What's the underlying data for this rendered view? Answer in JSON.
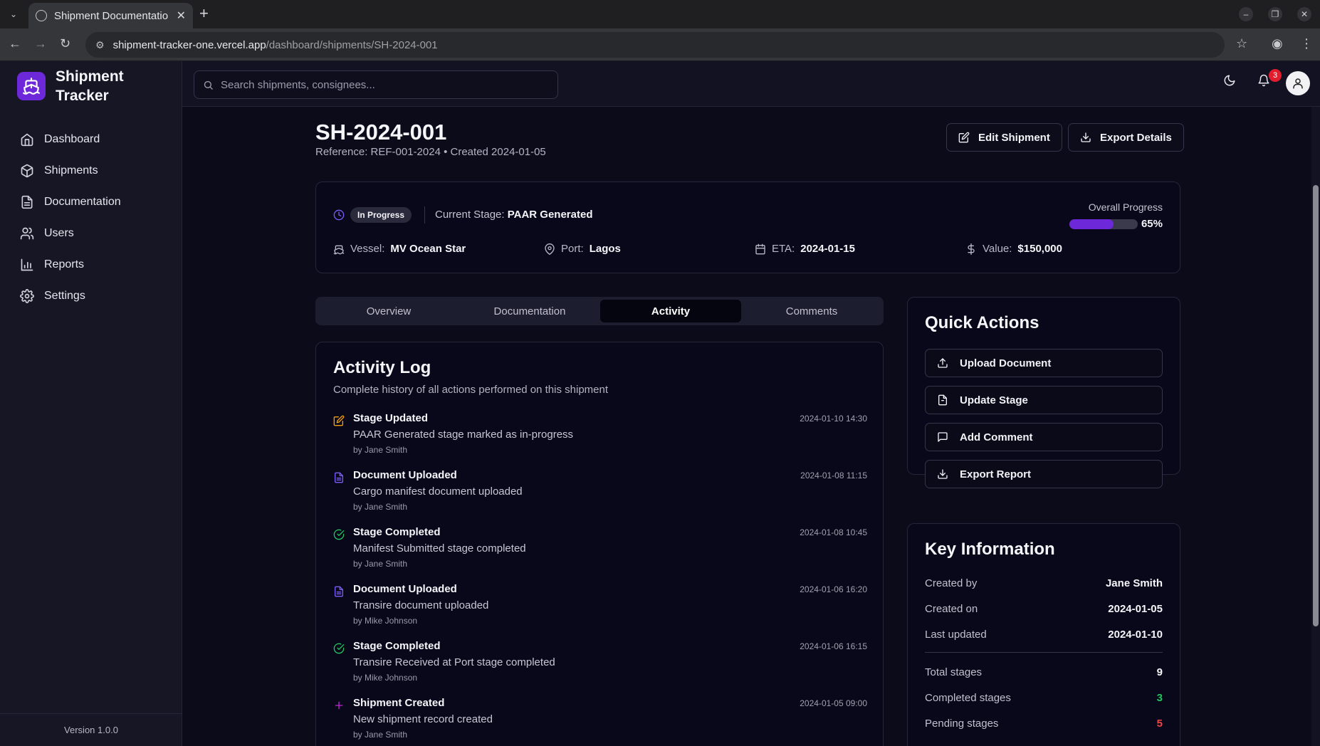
{
  "browser": {
    "tab_title": "Shipment Documentatio",
    "url_host": "shipment-tracker-one.vercel.app",
    "url_path": "/dashboard/shipments/SH-2024-001"
  },
  "brand": {
    "name": "Shipment Tracker",
    "accent": "#6d28d9"
  },
  "sidebar": {
    "items": [
      {
        "label": "Dashboard",
        "icon": "home-icon"
      },
      {
        "label": "Shipments",
        "icon": "package-icon"
      },
      {
        "label": "Documentation",
        "icon": "file-text-icon"
      },
      {
        "label": "Users",
        "icon": "users-icon"
      },
      {
        "label": "Reports",
        "icon": "bar-chart-icon"
      },
      {
        "label": "Settings",
        "icon": "gear-icon"
      }
    ],
    "version": "Version 1.0.0"
  },
  "topbar": {
    "search_placeholder": "Search shipments, consignees...",
    "notification_count": "3"
  },
  "shipment": {
    "id": "SH-2024-001",
    "subtitle": "Reference: REF-001-2024 • Created 2024-01-05",
    "edit_label": "Edit Shipment",
    "export_label": "Export Details",
    "status": "In Progress",
    "stage_label": "Current Stage:",
    "stage_value": "PAAR Generated",
    "progress_label": "Overall Progress",
    "progress_value": 65,
    "progress_text": "65%",
    "vessel_label": "Vessel:",
    "vessel_value": "MV Ocean Star",
    "port_label": "Port:",
    "port_value": "Lagos",
    "eta_label": "ETA:",
    "eta_value": "2024-01-15",
    "value_label": "Value:",
    "value_value": "$150,000"
  },
  "tabs": [
    "Overview",
    "Documentation",
    "Activity",
    "Comments"
  ],
  "activity": {
    "title": "Activity Log",
    "subtitle": "Complete history of all actions performed on this shipment",
    "items": [
      {
        "title": "Stage Updated",
        "desc": "PAAR Generated stage marked as in-progress",
        "by": "by Jane Smith",
        "ts": "2024-01-10 14:30",
        "icon": "edit-icon",
        "color": "#f59e0b"
      },
      {
        "title": "Document Uploaded",
        "desc": "Cargo manifest document uploaded",
        "by": "by Jane Smith",
        "ts": "2024-01-08 11:15",
        "icon": "file-icon",
        "color": "#7c5cf5"
      },
      {
        "title": "Stage Completed",
        "desc": "Manifest Submitted stage completed",
        "by": "by Jane Smith",
        "ts": "2024-01-08 10:45",
        "icon": "check-circle-icon",
        "color": "#22c55e"
      },
      {
        "title": "Document Uploaded",
        "desc": "Transire document uploaded",
        "by": "by Mike Johnson",
        "ts": "2024-01-06 16:20",
        "icon": "file-icon",
        "color": "#7c5cf5"
      },
      {
        "title": "Stage Completed",
        "desc": "Transire Received at Port stage completed",
        "by": "by Mike Johnson",
        "ts": "2024-01-06 16:15",
        "icon": "check-circle-icon",
        "color": "#22c55e"
      },
      {
        "title": "Shipment Created",
        "desc": "New shipment record created",
        "by": "by Jane Smith",
        "ts": "2024-01-05 09:00",
        "icon": "plus-icon",
        "color": "#c026d3"
      }
    ]
  },
  "quick_actions": {
    "title": "Quick Actions",
    "items": [
      {
        "label": "Upload Document",
        "icon": "upload-icon"
      },
      {
        "label": "Update Stage",
        "icon": "file-icon"
      },
      {
        "label": "Add Comment",
        "icon": "message-icon"
      },
      {
        "label": "Export Report",
        "icon": "download-icon"
      }
    ]
  },
  "key_info": {
    "title": "Key Information",
    "rows": [
      {
        "label": "Created by",
        "value": "Jane Smith"
      },
      {
        "label": "Created on",
        "value": "2024-01-05"
      },
      {
        "label": "Last updated",
        "value": "2024-01-10"
      }
    ],
    "stats": [
      {
        "label": "Total stages",
        "value": "9",
        "color": "#f5f5fa"
      },
      {
        "label": "Completed stages",
        "value": "3",
        "color": "#22c55e"
      },
      {
        "label": "Pending stages",
        "value": "5",
        "color": "#ef4444"
      }
    ]
  }
}
